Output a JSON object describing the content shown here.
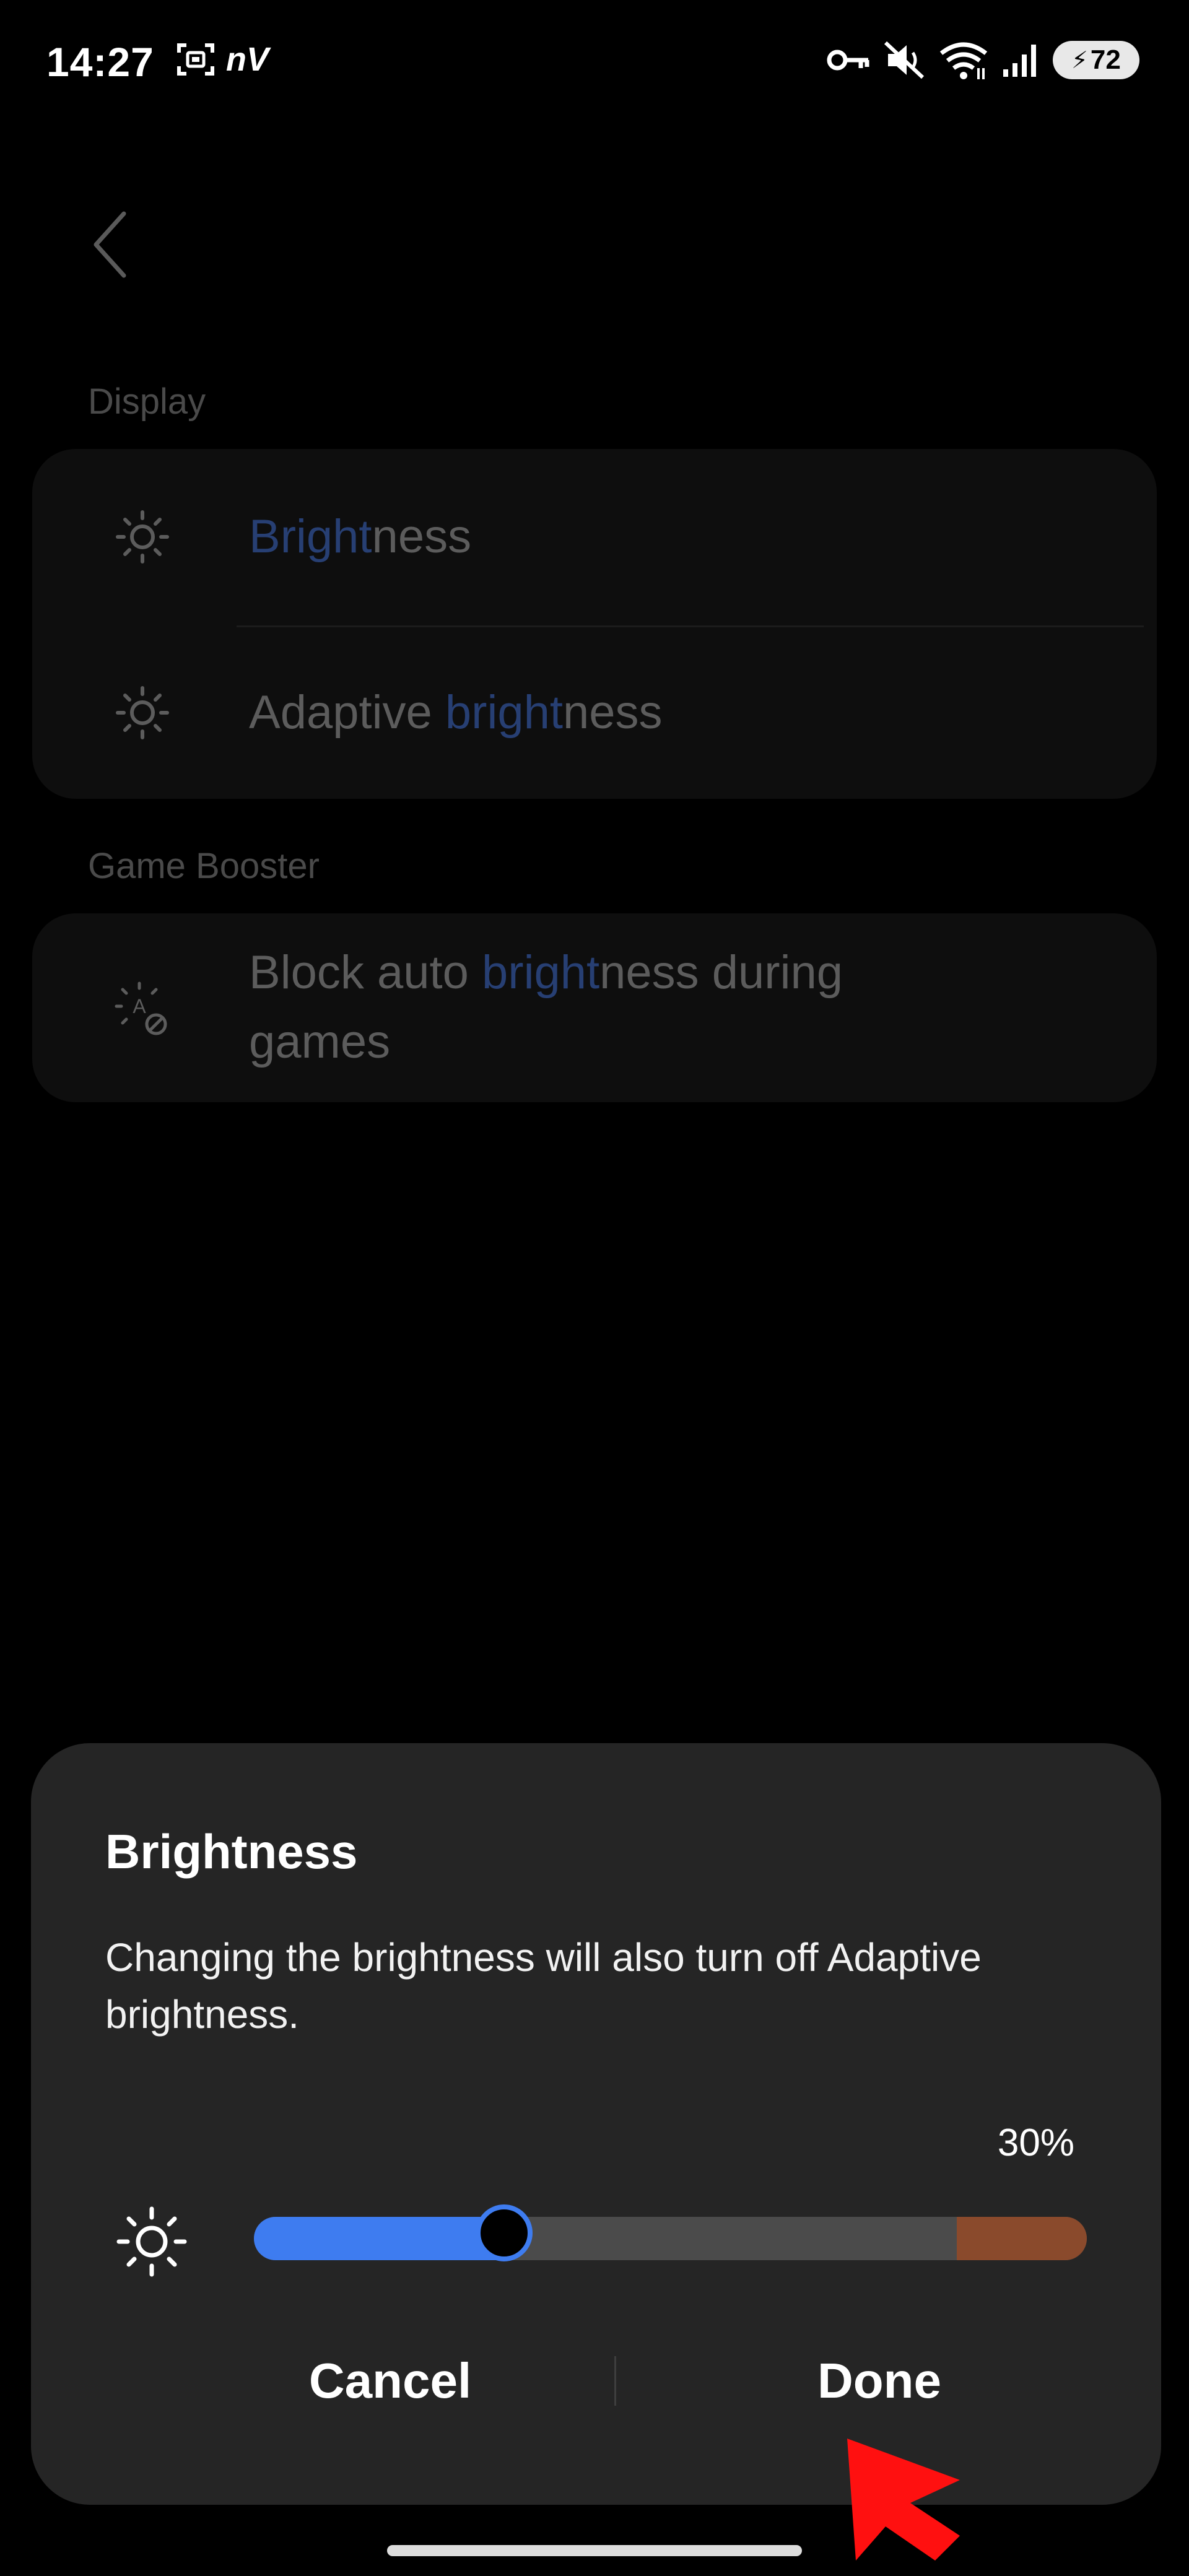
{
  "status_bar": {
    "time": "14:27",
    "left_icons": [
      "screenshot-icon",
      "nv-app-icon"
    ],
    "nv_label": "nV",
    "right_icons": [
      "vpn-key-icon",
      "mute-icon",
      "wifi-icon",
      "signal-icon",
      "battery-icon"
    ],
    "battery_level": "72"
  },
  "background_page": {
    "sections": [
      {
        "header": "Display",
        "items": [
          {
            "prefix": "",
            "highlight": "Bright",
            "suffix": "ness",
            "icon": "sun-icon"
          },
          {
            "prefix": "Adaptive ",
            "highlight": "bright",
            "suffix": "ness",
            "icon": "sun-icon"
          }
        ]
      },
      {
        "header": "Game Booster",
        "items": [
          {
            "prefix": "Block auto ",
            "highlight": "bright",
            "suffix": "ness during",
            "line2": "games",
            "icon": "auto-brightness-off-icon"
          }
        ]
      }
    ]
  },
  "dialog": {
    "title": "Brightness",
    "message": "Changing the brightness will also turn off Adaptive brightness.",
    "percent_label": "30%",
    "slider_value": 0.3,
    "cancel_label": "Cancel",
    "done_label": "Done"
  },
  "colors": {
    "accent": "#3e7cf0",
    "slider_extra": "#8a4a2c",
    "dialog_bg": "#252525",
    "highlight": "#273f73"
  }
}
